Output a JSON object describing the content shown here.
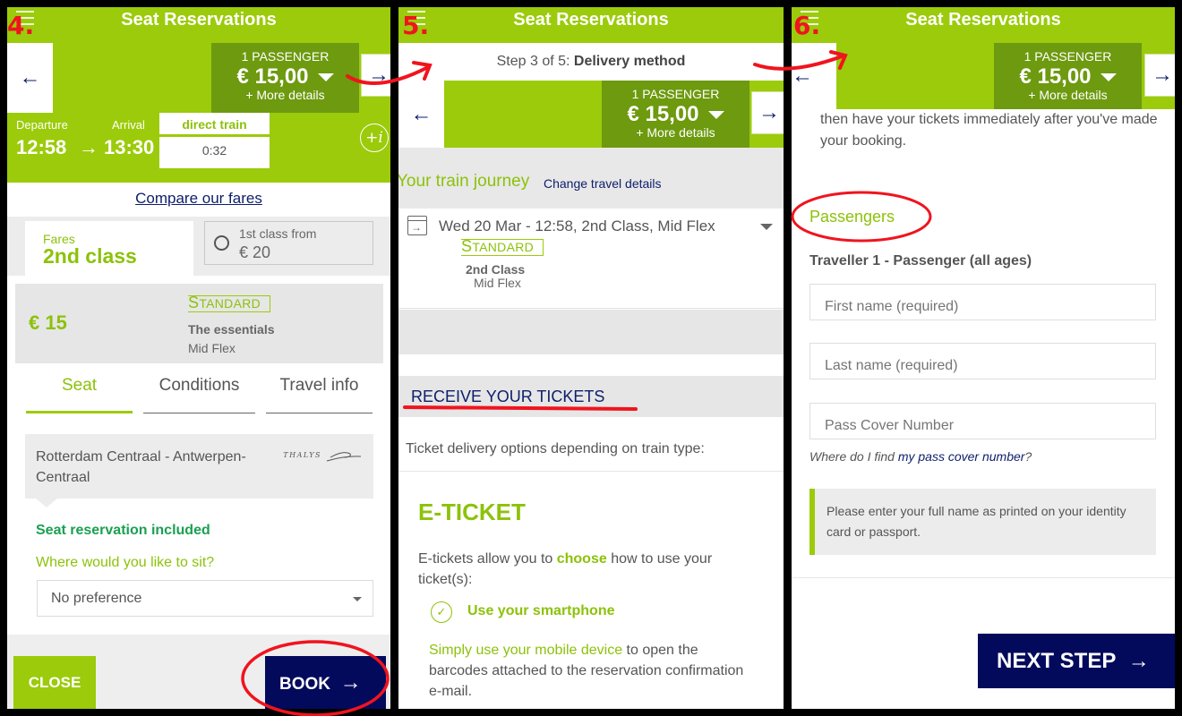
{
  "colors": {
    "brand_green": "#9bcb0a",
    "dark_green": "#6d9a0f",
    "navy": "#030a5c",
    "annotation_red": "#f0141e"
  },
  "annotations": {
    "step4": "4.",
    "step5": "5.",
    "step6": "6."
  },
  "header": {
    "title": "Seat Reservations",
    "menu_icon": "hamburger-icon"
  },
  "price_summary": {
    "passengers": "1 PASSENGER",
    "amount": "€ 15,00",
    "more": "+ More details",
    "back_icon": "←",
    "next_icon": "→"
  },
  "screen4": {
    "departure_label": "Departure",
    "departure_time": "12:58",
    "arrival_label": "Arrival",
    "arrival_time": "13:30",
    "arrow": "→",
    "direct_label": "direct train",
    "duration": "0:32",
    "info_icon": "+i",
    "compare_link": "Compare our fares",
    "fares_small": "Fares",
    "fares_class": "2nd class",
    "first_class_label": "1st class  from",
    "first_class_price": "€ 20",
    "fare_price": "€ 15",
    "badge_first": "S",
    "badge_rest": "TANDARD",
    "fare_name": "The essentials",
    "fare_flex": "Mid Flex",
    "tabs": [
      "Seat",
      "Conditions",
      "Travel info"
    ],
    "route": "Rotterdam Centraal - Antwerpen-Centraal",
    "operator": "THALYS",
    "seat_included": "Seat reservation included",
    "seat_question": "Where would you like to sit?",
    "seat_pref": "No preference",
    "close_label": "CLOSE",
    "book_label": "BOOK",
    "book_arrow": "→"
  },
  "screen5": {
    "step_prefix": "Step 3 of 5: ",
    "step_name": "Delivery method",
    "journey_heading": "Your train journey",
    "change_link": "Change travel details",
    "journey_line": "Wed 20 Mar - 12:58, 2nd Class, Mid Flex",
    "badge_first": "S",
    "badge_rest": "TANDARD",
    "class": "2nd Class",
    "flex": "Mid Flex",
    "receive_heading": "RECEIVE YOUR TICKETS",
    "delivery_text": "Ticket delivery options depending on train type:",
    "eticket_heading": "E-TICKET",
    "etext_1": "E-tickets allow you to ",
    "etext_choose": "choose",
    "etext_2": " how to use your ticket(s):",
    "check_icon": "✓",
    "smartphone_label": "Use your smartphone",
    "simply_green": "Simply use your mobile device",
    "simply_rest": " to open the barcodes attached to the reservation confirmation e-mail."
  },
  "screen6": {
    "intro_text": "then have your tickets immediately after you've made your booking.",
    "passengers_heading": "Passengers",
    "traveller_label": "Traveller 1 - Passenger (all ages)",
    "first_name_placeholder": "First name (required)",
    "last_name_placeholder": "Last name (required)",
    "pass_cover_placeholder": "Pass Cover Number",
    "where_find_1": "Where do I find ",
    "where_find_link": "my pass cover number",
    "where_find_2": "?",
    "note": "Please enter your full name as printed on your identity card or passport.",
    "next_label": "NEXT STEP",
    "next_arrow": "→"
  }
}
